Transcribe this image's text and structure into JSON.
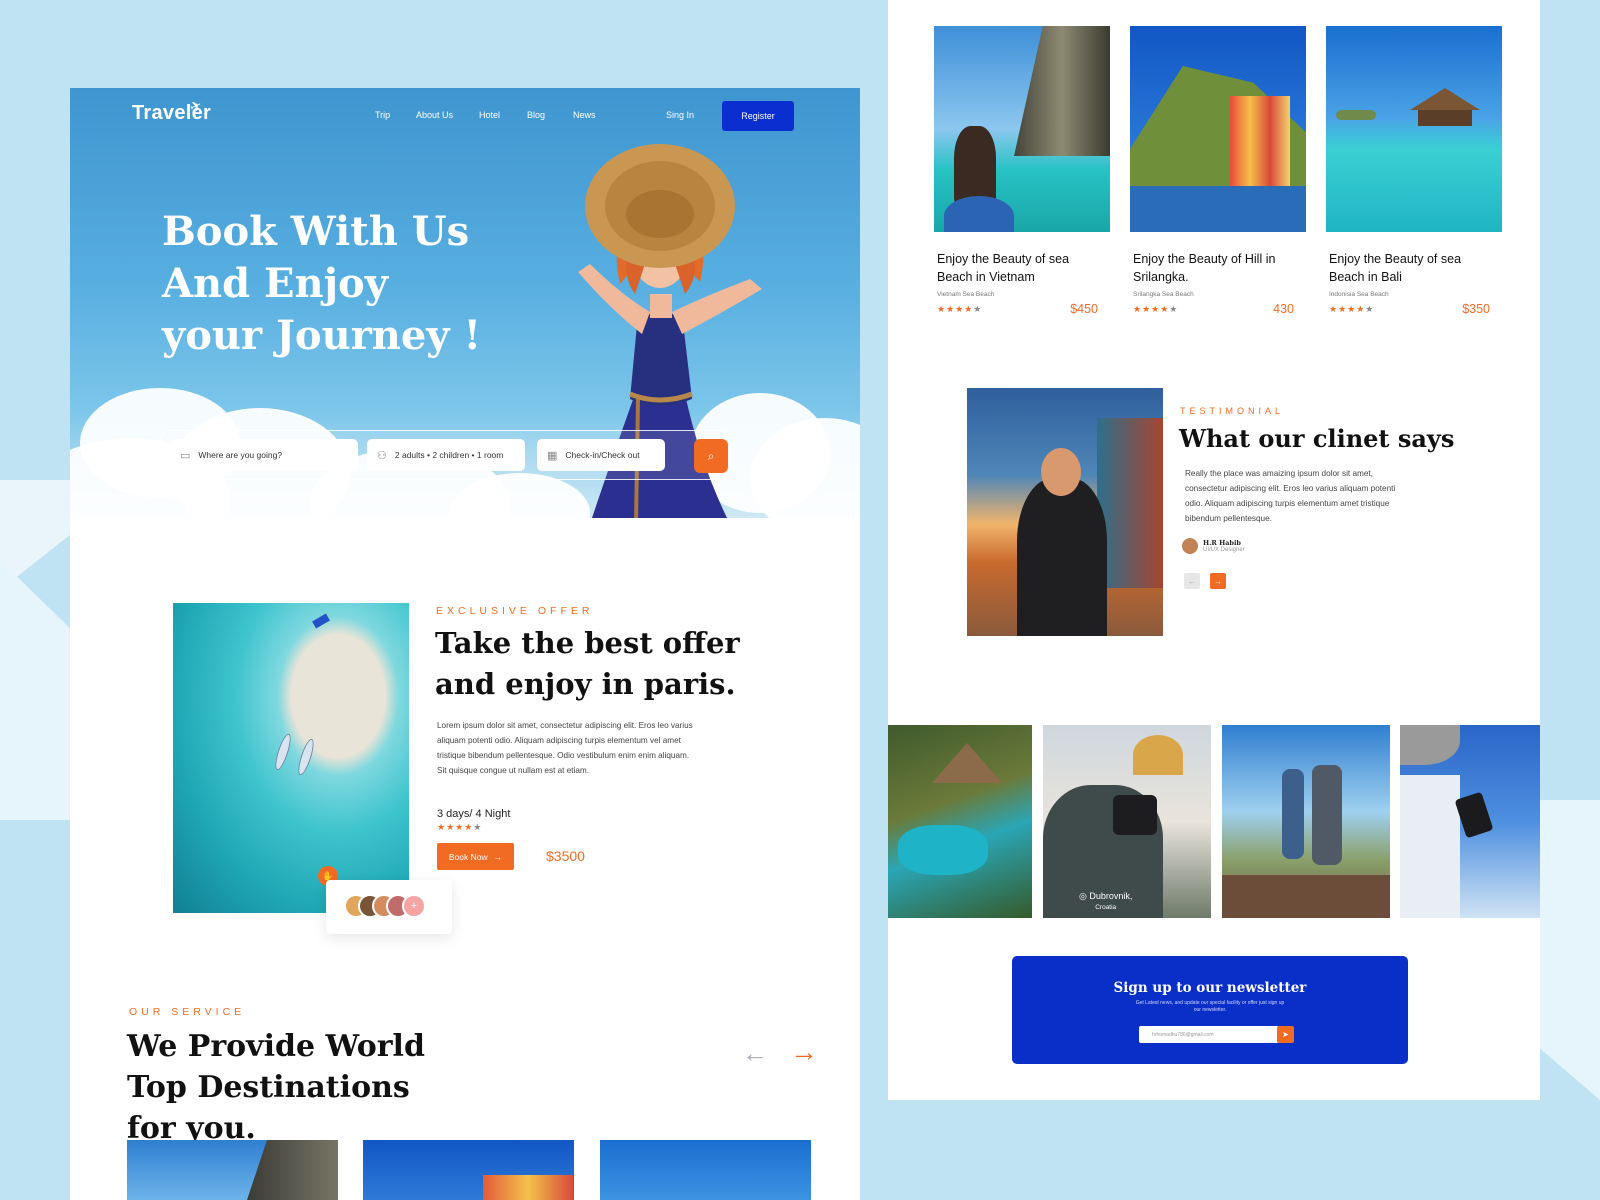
{
  "nav": {
    "logo": "Traveler",
    "links": [
      "Trip",
      "About Us",
      "Hotel",
      "Blog",
      "News"
    ],
    "signin": "Sing In",
    "register": "Register"
  },
  "hero": {
    "title": "Book With  Us And Enjoy your Journey !",
    "search": {
      "destination_placeholder": "Where are you going?",
      "guests": "2 adults • 2 children  •  1 room",
      "dates": "Check-in/Check out"
    }
  },
  "offer": {
    "eyebrow": "EXCLUSIVE OFFER",
    "title": "Take the best offer and enjoy in paris.",
    "text": "Lorem ipsum dolor sit amet, consectetur adipiscing elit. Eros leo varius aliquam potenti odio. Aliquam adipiscing turpis elementum vel amet tristique bibendum pellentesque. Odio vestibulum enim enim aliquam. Sit quisque congue ut nullam est at etiam.",
    "duration": "3 days/ 4 Night",
    "rating": 4,
    "book_label": "Book Now",
    "price": "$3500"
  },
  "service": {
    "eyebrow": "OUR SERVICE",
    "title": "We Provide World Top Destinations for you."
  },
  "destinations": [
    {
      "title": "Enjoy the Beauty of sea Beach in Vietnam",
      "sub": "Vietnam Sea Beach",
      "rating": 4,
      "price": "$450"
    },
    {
      "title": "Enjoy the Beauty of Hill in Srilangka.",
      "sub": "Srilangka Sea Beach",
      "rating": 4,
      "price": "430"
    },
    {
      "title": "Enjoy the Beauty of sea Beach in Bali",
      "sub": "Indonisia Sea Beach",
      "rating": 4,
      "price": "$350"
    }
  ],
  "testimonial": {
    "eyebrow": "TESTIMONIAL",
    "title": "What our clinet says",
    "text": "Really the place was amaizing  ipsum dolor sit amet, consectetur adipiscing elit. Eros leo varius aliquam potenti odio. Aliquam adipiscing turpis elementum amet tristique bibendum pellentesque.",
    "author": "H.R Habib",
    "role": "UI/UX Designer"
  },
  "gallery": {
    "caption_city": "Dubrovnik,",
    "caption_country": "Croatia"
  },
  "newsletter": {
    "title": "Sign up to our newsletter",
    "subtitle": "Get Latest news, and update our  special facility or offer just sign up our newsletter.",
    "email_placeholder": "hrhomadhu786@gmail.com"
  },
  "colors": {
    "accent": "#f26b23",
    "brand": "#0a2ed0",
    "background": "#bfe3f2"
  }
}
